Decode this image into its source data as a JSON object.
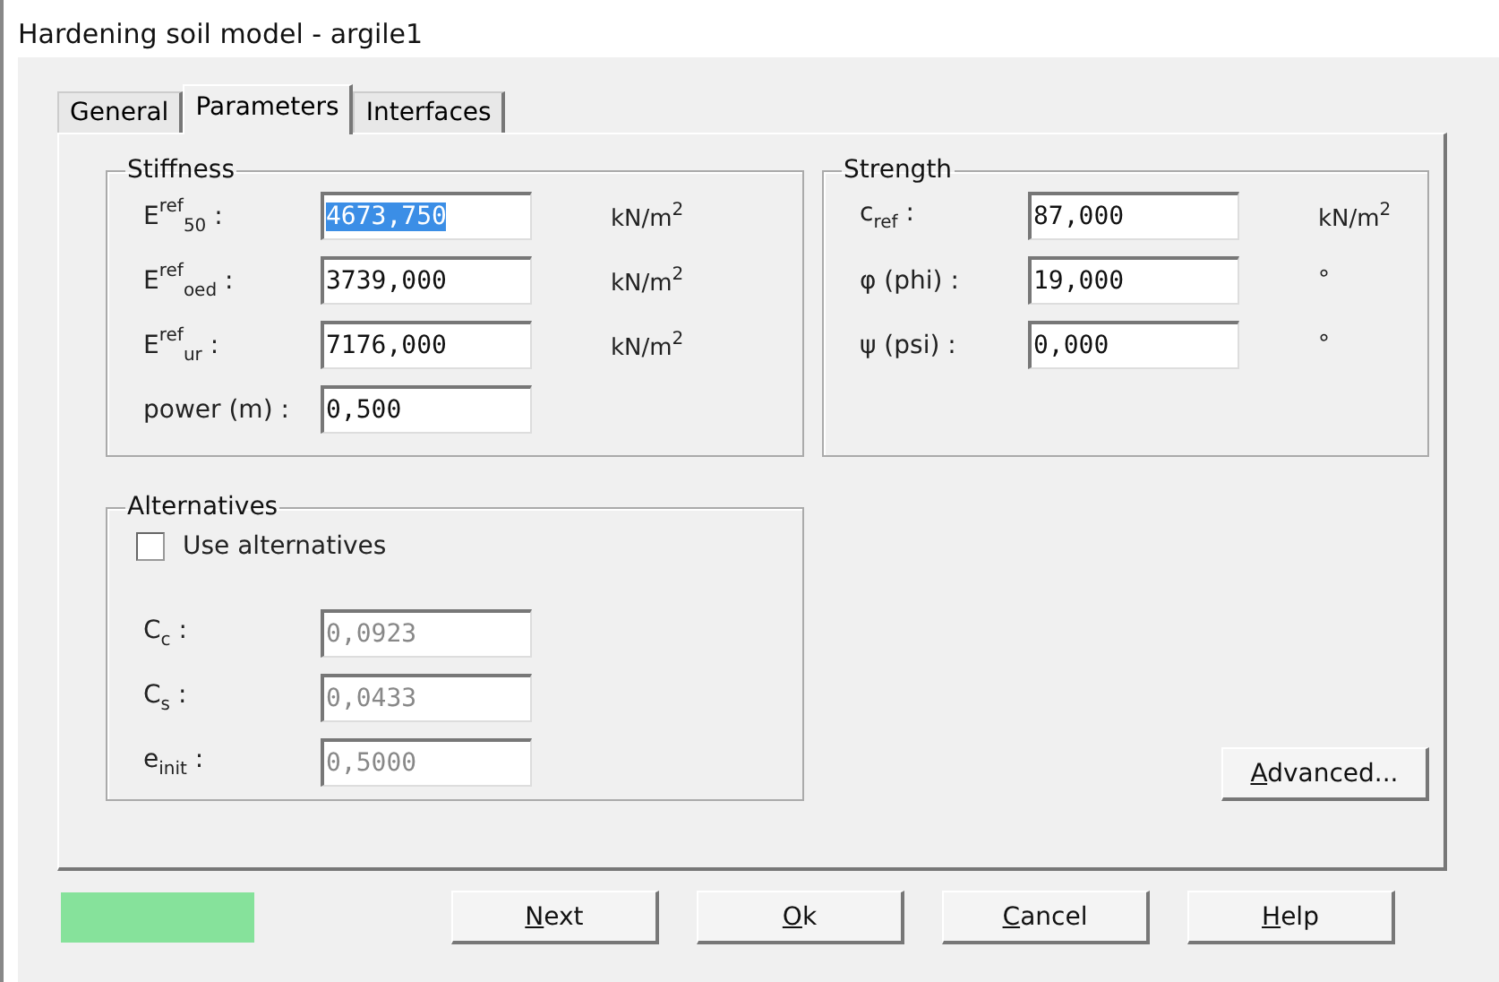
{
  "window": {
    "title": "Hardening soil model - argile1"
  },
  "tabs": [
    {
      "label": "General",
      "selected": false
    },
    {
      "label": "Parameters",
      "selected": true
    },
    {
      "label": "Interfaces",
      "selected": false
    }
  ],
  "stiffness": {
    "title": "Stiffness",
    "rows": [
      {
        "label": "E$^{ref}$$_{50}$ :",
        "value": "4673,750",
        "unit": "kN/m$^{2}$",
        "selected": true
      },
      {
        "label": "E$^{ref}$$_{oed}$ :",
        "value": "3739,000",
        "unit": "kN/m$^{2}$",
        "selected": false
      },
      {
        "label": "E$^{ref}$$_{ur}$ :",
        "value": "7176,000",
        "unit": "kN/m$^{2}$",
        "selected": false
      },
      {
        "label": "power (m) :",
        "value": "0,500",
        "selected": false
      }
    ]
  },
  "strength": {
    "title": "Strength",
    "rows": [
      {
        "label": "c$_{ref}$ :",
        "value": "87,000",
        "unit": "kN/m$^{2}$",
        "selected": false
      },
      {
        "label": "φ (phi) :",
        "value": "19,000",
        "unit": "°",
        "selected": false
      },
      {
        "label": "ψ (psi) :",
        "value": "0,000",
        "unit": "°",
        "selected": false
      }
    ]
  },
  "alternatives": {
    "title": "Alternatives",
    "checkbox": {
      "label": "Use alternatives",
      "checked": false
    },
    "rows": [
      {
        "label": "C$_{c}$ :",
        "value": "0,0923",
        "disabled": true
      },
      {
        "label": "C$_{s}$ :",
        "value": "0,0433",
        "disabled": true
      },
      {
        "label": "e$_{init}$ :",
        "value": "0,5000",
        "disabled": true
      }
    ]
  },
  "advanced_button": {
    "underlined": "A",
    "after": "dvanced..."
  },
  "status_block": {
    "color": "#86e29b"
  },
  "buttons": [
    {
      "underlined": "N",
      "after": "ext"
    },
    {
      "underlined": "O",
      "after": "k"
    },
    {
      "underlined": "C",
      "after": "ancel"
    },
    {
      "underlined": "H",
      "after": "elp"
    }
  ]
}
